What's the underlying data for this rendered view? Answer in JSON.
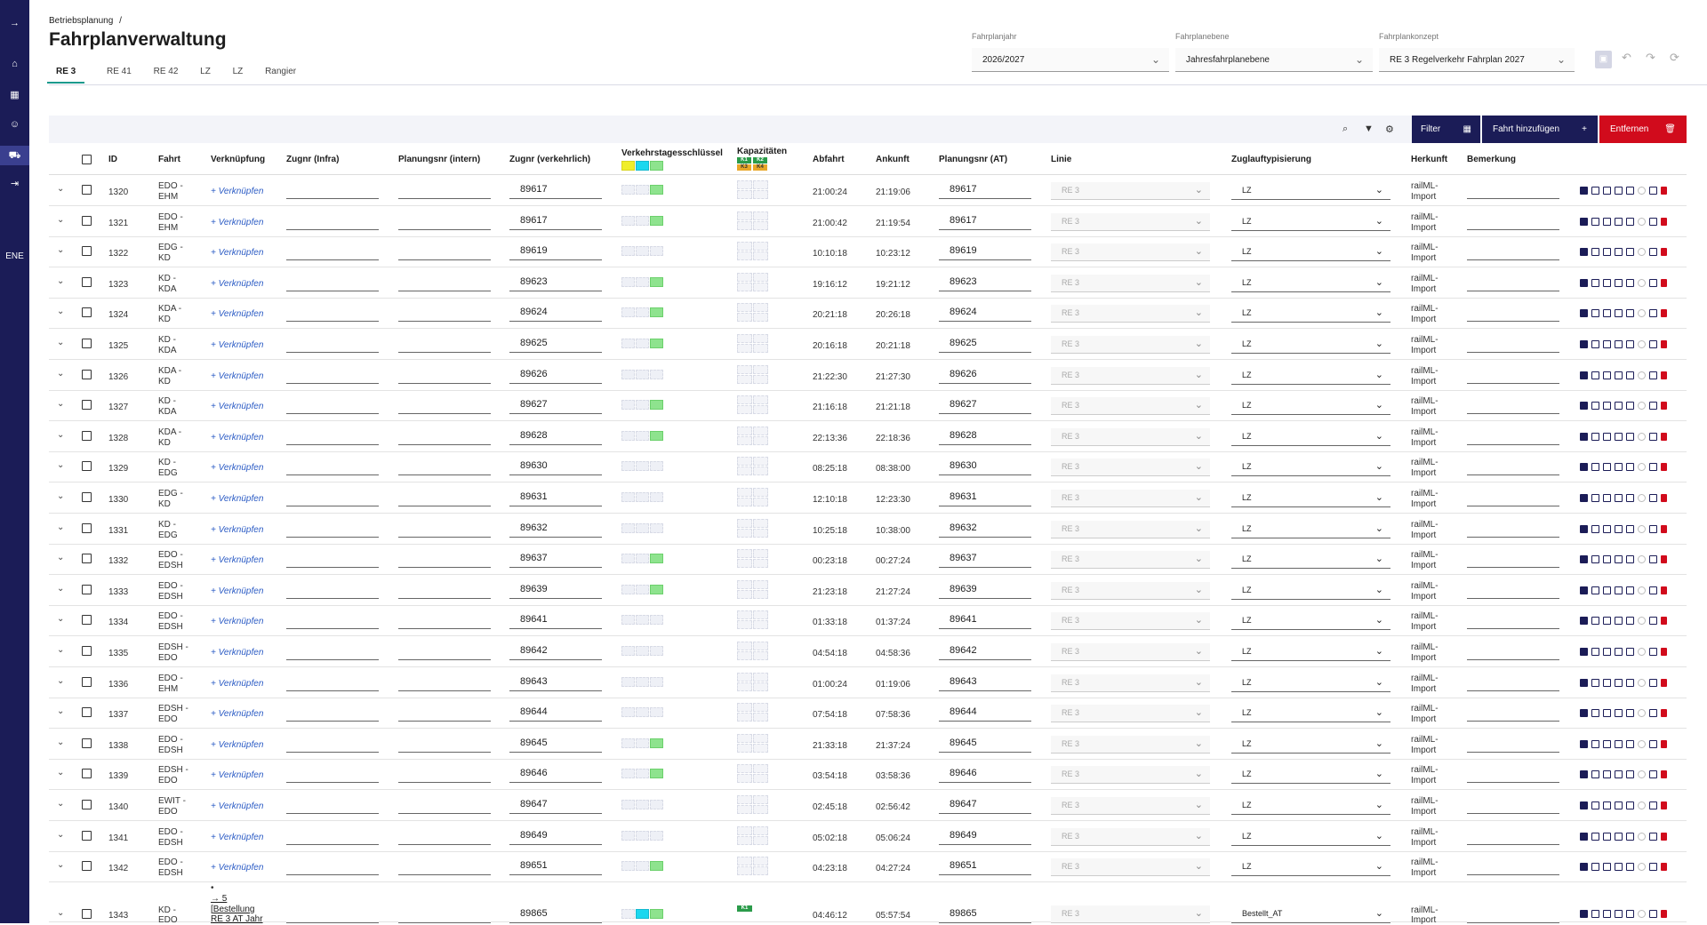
{
  "sidebar": {
    "icons": [
      "arrow-right-icon",
      "home-icon",
      "calendar-icon",
      "users-icon",
      "train-route-icon",
      "logout-icon"
    ],
    "user_label": "ENE"
  },
  "header": {
    "breadcrumb": "Betriebsplanung",
    "breadcrumb_sep": "/",
    "title": "Fahrplanverwaltung",
    "tabs": [
      "RE 3",
      "RE 41",
      "RE 42",
      "LZ",
      "LZ",
      "Rangier"
    ],
    "active_tab": "RE 3"
  },
  "selectors": {
    "fahrplanjahr": {
      "label": "Fahrplanjahr",
      "value": "2026/2027"
    },
    "fahrplanebene": {
      "label": "Fahrplanebene",
      "value": "Jahresfahrplanebene"
    },
    "fahrplankonzept": {
      "label": "Fahrplankonzept",
      "value": "RE 3 Regelverkehr Fahrplan 2027"
    }
  },
  "toolbar": {
    "filter_label": "Filter",
    "add_label": "Fahrt hinzufügen",
    "add_symbol": "+",
    "delete_label": "Entfernen"
  },
  "columns": {
    "id": "ID",
    "fahrt": "Fahrt",
    "verknuepfung": "Verknüpfung",
    "zugnr_infra": "Zugnr (Infra)",
    "planungsnr_intern": "Planungsnr (intern)",
    "zugnr_verkehrlich": "Zugnr (verkehrlich)",
    "verkehrstage": "Verkehrstagesschlüssel",
    "kapazitaeten": "Kapazitäten",
    "abfahrt": "Abfahrt",
    "ankunft": "Ankunft",
    "planungsnr_at": "Planungsnr (AT)",
    "linie": "Linie",
    "zuglauf": "Zuglauftypisierung",
    "herkunft": "Herkunft",
    "bemerkung": "Bemerkung"
  },
  "kap_legend": [
    "K1",
    "K2",
    "K3",
    "K4"
  ],
  "rows": [
    {
      "id": "1320",
      "fahrt1": "EDO -",
      "fahrt2": "EHM",
      "link": "+ Verknüpfen",
      "zugnr": "89617",
      "g": 1,
      "ab": "21:00:24",
      "an": "21:19:06",
      "plan": "89617",
      "linie": "RE 3",
      "zuglauf": "LZ",
      "herk1": "railML-",
      "herk2": "Import"
    },
    {
      "id": "1321",
      "fahrt1": "EDO -",
      "fahrt2": "EHM",
      "link": "+ Verknüpfen",
      "zugnr": "89617",
      "g": 1,
      "ab": "21:00:42",
      "an": "21:19:54",
      "plan": "89617",
      "linie": "RE 3",
      "zuglauf": "LZ",
      "herk1": "railML-",
      "herk2": "Import"
    },
    {
      "id": "1322",
      "fahrt1": "EDG -",
      "fahrt2": "KD",
      "link": "+ Verknüpfen",
      "zugnr": "89619",
      "g": 0,
      "ab": "10:10:18",
      "an": "10:23:12",
      "plan": "89619",
      "linie": "RE 3",
      "zuglauf": "LZ",
      "herk1": "railML-",
      "herk2": "Import"
    },
    {
      "id": "1323",
      "fahrt1": "KD -",
      "fahrt2": "KDA",
      "link": "+ Verknüpfen",
      "zugnr": "89623",
      "g": 1,
      "ab": "19:16:12",
      "an": "19:21:12",
      "plan": "89623",
      "linie": "RE 3",
      "zuglauf": "LZ",
      "herk1": "railML-",
      "herk2": "Import"
    },
    {
      "id": "1324",
      "fahrt1": "KDA -",
      "fahrt2": "KD",
      "link": "+ Verknüpfen",
      "zugnr": "89624",
      "g": 1,
      "ab": "20:21:18",
      "an": "20:26:18",
      "plan": "89624",
      "linie": "RE 3",
      "zuglauf": "LZ",
      "herk1": "railML-",
      "herk2": "Import"
    },
    {
      "id": "1325",
      "fahrt1": "KD -",
      "fahrt2": "KDA",
      "link": "+ Verknüpfen",
      "zugnr": "89625",
      "g": 1,
      "ab": "20:16:18",
      "an": "20:21:18",
      "plan": "89625",
      "linie": "RE 3",
      "zuglauf": "LZ",
      "herk1": "railML-",
      "herk2": "Import"
    },
    {
      "id": "1326",
      "fahrt1": "KDA -",
      "fahrt2": "KD",
      "link": "+ Verknüpfen",
      "zugnr": "89626",
      "g": 0,
      "ab": "21:22:30",
      "an": "21:27:30",
      "plan": "89626",
      "linie": "RE 3",
      "zuglauf": "LZ",
      "herk1": "railML-",
      "herk2": "Import"
    },
    {
      "id": "1327",
      "fahrt1": "KD -",
      "fahrt2": "KDA",
      "link": "+ Verknüpfen",
      "zugnr": "89627",
      "g": 1,
      "ab": "21:16:18",
      "an": "21:21:18",
      "plan": "89627",
      "linie": "RE 3",
      "zuglauf": "LZ",
      "herk1": "railML-",
      "herk2": "Import"
    },
    {
      "id": "1328",
      "fahrt1": "KDA -",
      "fahrt2": "KD",
      "link": "+ Verknüpfen",
      "zugnr": "89628",
      "g": 1,
      "ab": "22:13:36",
      "an": "22:18:36",
      "plan": "89628",
      "linie": "RE 3",
      "zuglauf": "LZ",
      "herk1": "railML-",
      "herk2": "Import"
    },
    {
      "id": "1329",
      "fahrt1": "KD -",
      "fahrt2": "EDG",
      "link": "+ Verknüpfen",
      "zugnr": "89630",
      "g": 0,
      "ab": "08:25:18",
      "an": "08:38:00",
      "plan": "89630",
      "linie": "RE 3",
      "zuglauf": "LZ",
      "herk1": "railML-",
      "herk2": "Import"
    },
    {
      "id": "1330",
      "fahrt1": "EDG -",
      "fahrt2": "KD",
      "link": "+ Verknüpfen",
      "zugnr": "89631",
      "g": 0,
      "ab": "12:10:18",
      "an": "12:23:30",
      "plan": "89631",
      "linie": "RE 3",
      "zuglauf": "LZ",
      "herk1": "railML-",
      "herk2": "Import"
    },
    {
      "id": "1331",
      "fahrt1": "KD -",
      "fahrt2": "EDG",
      "link": "+ Verknüpfen",
      "zugnr": "89632",
      "g": 0,
      "ab": "10:25:18",
      "an": "10:38:00",
      "plan": "89632",
      "linie": "RE 3",
      "zuglauf": "LZ",
      "herk1": "railML-",
      "herk2": "Import"
    },
    {
      "id": "1332",
      "fahrt1": "EDO -",
      "fahrt2": "EDSH",
      "link": "+ Verknüpfen",
      "zugnr": "89637",
      "g": 1,
      "ab": "00:23:18",
      "an": "00:27:24",
      "plan": "89637",
      "linie": "RE 3",
      "zuglauf": "LZ",
      "herk1": "railML-",
      "herk2": "Import"
    },
    {
      "id": "1333",
      "fahrt1": "EDO -",
      "fahrt2": "EDSH",
      "link": "+ Verknüpfen",
      "zugnr": "89639",
      "g": 1,
      "ab": "21:23:18",
      "an": "21:27:24",
      "plan": "89639",
      "linie": "RE 3",
      "zuglauf": "LZ",
      "herk1": "railML-",
      "herk2": "Import"
    },
    {
      "id": "1334",
      "fahrt1": "EDO -",
      "fahrt2": "EDSH",
      "link": "+ Verknüpfen",
      "zugnr": "89641",
      "g": 0,
      "ab": "01:33:18",
      "an": "01:37:24",
      "plan": "89641",
      "linie": "RE 3",
      "zuglauf": "LZ",
      "herk1": "railML-",
      "herk2": "Import"
    },
    {
      "id": "1335",
      "fahrt1": "EDSH -",
      "fahrt2": "EDO",
      "link": "+ Verknüpfen",
      "zugnr": "89642",
      "g": 0,
      "ab": "04:54:18",
      "an": "04:58:36",
      "plan": "89642",
      "linie": "RE 3",
      "zuglauf": "LZ",
      "herk1": "railML-",
      "herk2": "Import"
    },
    {
      "id": "1336",
      "fahrt1": "EDO -",
      "fahrt2": "EHM",
      "link": "+ Verknüpfen",
      "zugnr": "89643",
      "g": 0,
      "ab": "01:00:24",
      "an": "01:19:06",
      "plan": "89643",
      "linie": "RE 3",
      "zuglauf": "LZ",
      "herk1": "railML-",
      "herk2": "Import"
    },
    {
      "id": "1337",
      "fahrt1": "EDSH -",
      "fahrt2": "EDO",
      "link": "+ Verknüpfen",
      "zugnr": "89644",
      "g": 0,
      "ab": "07:54:18",
      "an": "07:58:36",
      "plan": "89644",
      "linie": "RE 3",
      "zuglauf": "LZ",
      "herk1": "railML-",
      "herk2": "Import"
    },
    {
      "id": "1338",
      "fahrt1": "EDO -",
      "fahrt2": "EDSH",
      "link": "+ Verknüpfen",
      "zugnr": "89645",
      "g": 1,
      "ab": "21:33:18",
      "an": "21:37:24",
      "plan": "89645",
      "linie": "RE 3",
      "zuglauf": "LZ",
      "herk1": "railML-",
      "herk2": "Import"
    },
    {
      "id": "1339",
      "fahrt1": "EDSH -",
      "fahrt2": "EDO",
      "link": "+ Verknüpfen",
      "zugnr": "89646",
      "g": 1,
      "ab": "03:54:18",
      "an": "03:58:36",
      "plan": "89646",
      "linie": "RE 3",
      "zuglauf": "LZ",
      "herk1": "railML-",
      "herk2": "Import"
    },
    {
      "id": "1340",
      "fahrt1": "EWIT -",
      "fahrt2": "EDO",
      "link": "+ Verknüpfen",
      "zugnr": "89647",
      "g": 0,
      "ab": "02:45:18",
      "an": "02:56:42",
      "plan": "89647",
      "linie": "RE 3",
      "zuglauf": "LZ",
      "herk1": "railML-",
      "herk2": "Import"
    },
    {
      "id": "1341",
      "fahrt1": "EDO -",
      "fahrt2": "EDSH",
      "link": "+ Verknüpfen",
      "zugnr": "89649",
      "g": 0,
      "ab": "05:02:18",
      "an": "05:06:24",
      "plan": "89649",
      "linie": "RE 3",
      "zuglauf": "LZ",
      "herk1": "railML-",
      "herk2": "Import"
    },
    {
      "id": "1342",
      "fahrt1": "EDO -",
      "fahrt2": "EDSH",
      "link": "+ Verknüpfen",
      "zugnr": "89651",
      "g": 1,
      "ab": "04:23:18",
      "an": "04:27:24",
      "plan": "89651",
      "linie": "RE 3",
      "zuglauf": "LZ",
      "herk1": "railML-",
      "herk2": "Import"
    }
  ],
  "last_row": {
    "id": "1343",
    "fahrt1": "KD -",
    "fahrt2": "EDO",
    "link1": "→ 5",
    "link2": "[Bestellung",
    "link3": "RE 3 AT Jahr",
    "zugnr": "89865",
    "kap": "K1",
    "ab": "04:46:12",
    "an": "05:57:54",
    "plan": "89865",
    "linie": "RE 3",
    "zuglauf": "Bestellt_AT",
    "herk1": "railML-",
    "herk2": "Import"
  }
}
